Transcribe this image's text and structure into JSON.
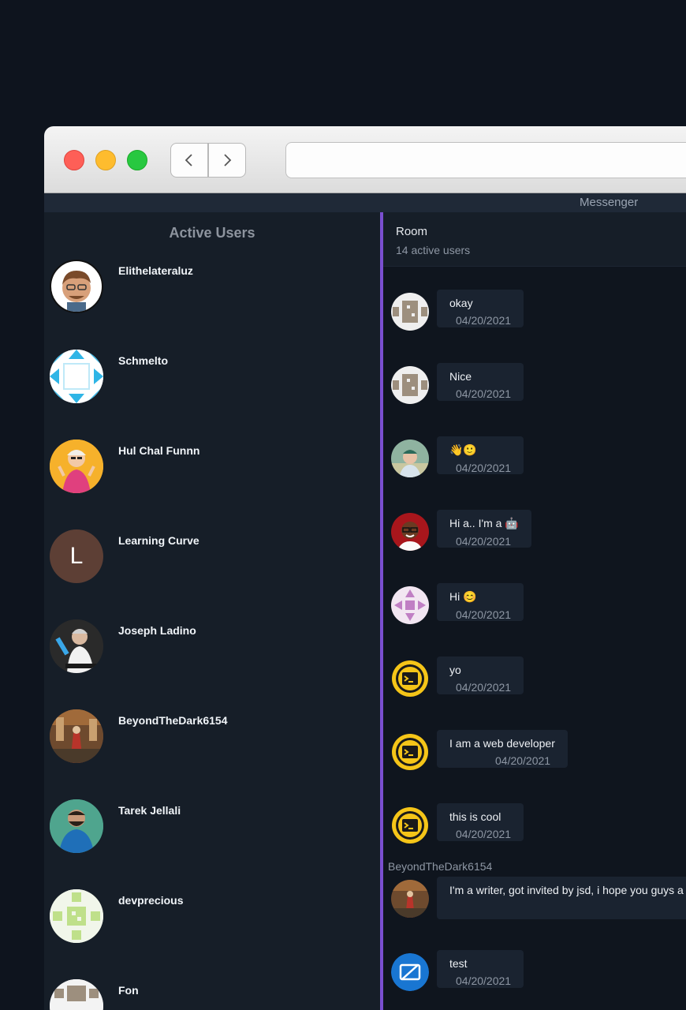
{
  "app": {
    "title": "Messenger"
  },
  "sidebar": {
    "title": "Active Users",
    "users": [
      {
        "name": "Elithelateraluz",
        "avatar": "cartoon-man-avatar"
      },
      {
        "name": "Schmelto",
        "avatar": "cyan-geometric-avatar"
      },
      {
        "name": "Hul Chal Funnn",
        "avatar": "yellow-photo-avatar"
      },
      {
        "name": "Learning Curve",
        "initial": "L",
        "avatar": "letter-avatar"
      },
      {
        "name": "Joseph Ladino",
        "avatar": "illustration-avatar"
      },
      {
        "name": "BeyondTheDark6154",
        "avatar": "painting-avatar"
      },
      {
        "name": "Tarek Jellali",
        "avatar": "photo-avatar"
      },
      {
        "name": "devprecious",
        "avatar": "green-identicon-avatar"
      },
      {
        "name": "Fon",
        "avatar": "grey-identicon-avatar"
      }
    ]
  },
  "room": {
    "title": "Room",
    "subtitle": "14 active users"
  },
  "messages": [
    {
      "text": "okay",
      "date": "04/20/2021",
      "avatar": "grey-identicon"
    },
    {
      "text": "Nice",
      "date": "04/20/2021",
      "avatar": "grey-identicon"
    },
    {
      "text": "👋🙂",
      "date": "04/20/2021",
      "avatar": "photo"
    },
    {
      "text": "Hi a.. I'm a 🤖",
      "date": "04/20/2021",
      "avatar": "photo-red"
    },
    {
      "text": "Hi 😊",
      "date": "04/20/2021",
      "avatar": "purple-identicon"
    },
    {
      "text": "yo",
      "date": "04/20/2021",
      "avatar": "terminal-icon"
    },
    {
      "text": "I am a web developer",
      "date": "04/20/2021",
      "avatar": "terminal-icon"
    },
    {
      "text": "this is cool",
      "date": "04/20/2021",
      "avatar": "terminal-icon"
    },
    {
      "sender": "BeyondTheDark6154",
      "text": "I'm a writer, got invited by jsd, i hope you guys a",
      "avatar": "painting"
    },
    {
      "text": "test",
      "date": "04/20/2021",
      "avatar": "blue-edit-icon"
    }
  ]
}
